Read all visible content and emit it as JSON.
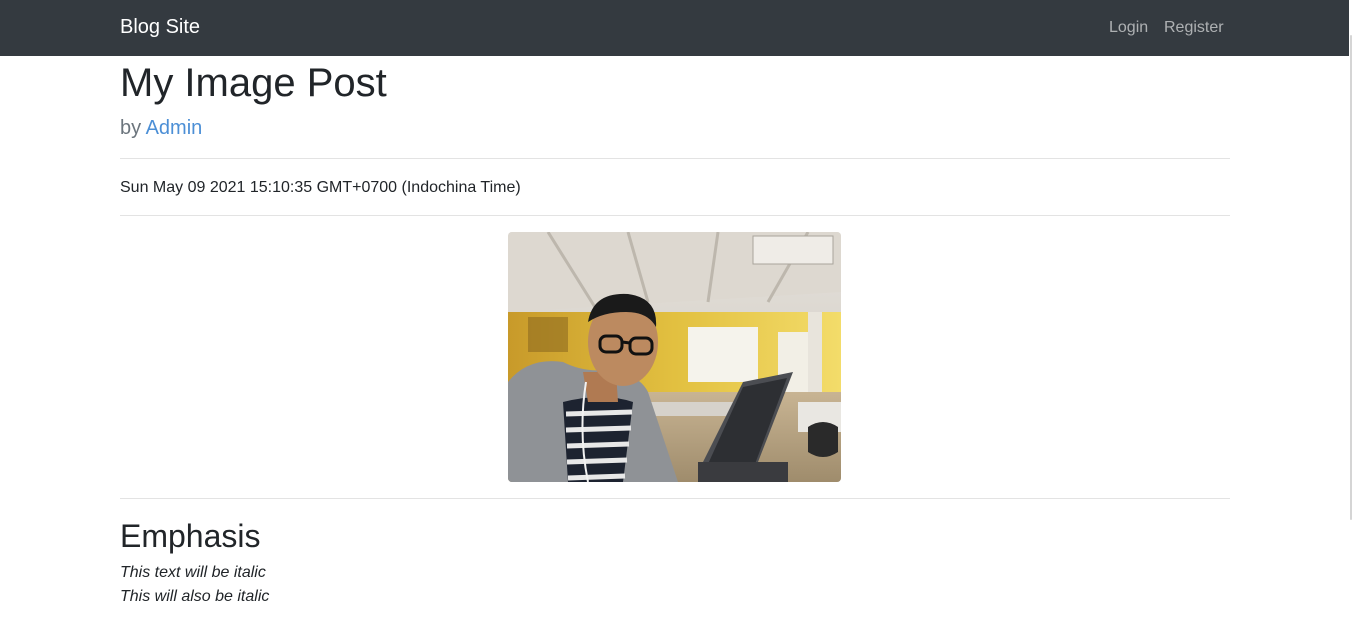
{
  "navbar": {
    "brand": "Blog Site",
    "links": {
      "login": "Login",
      "register": "Register"
    }
  },
  "post": {
    "title": "My Image Post",
    "byline_prefix": "by",
    "author": "Admin",
    "date": "Sun May 09 2021 15:10:35 GMT+0700 (Indochina Time)",
    "image_icon": "selfie-photo"
  },
  "content": {
    "heading": "Emphasis",
    "lines": [
      "This text will be italic",
      "This will also be italic"
    ]
  },
  "colors": {
    "navbar_bg": "#343a40",
    "link": "#4c8fd6",
    "text": "#212529",
    "muted": "#6c757d"
  }
}
